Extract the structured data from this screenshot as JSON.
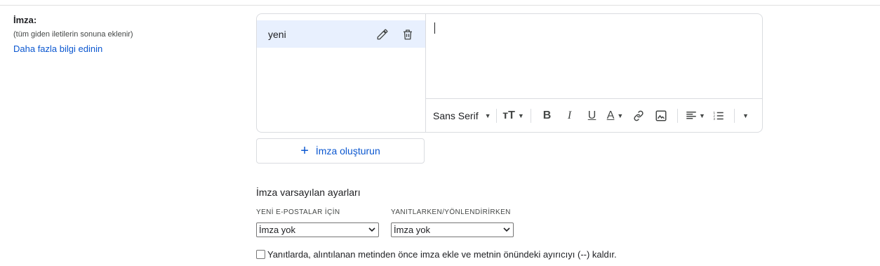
{
  "signature_section": {
    "label": "İmza:",
    "sublabel": "(tüm giden iletilerin sonuna eklenir)",
    "link": "Daha fazla bilgi edinin"
  },
  "signatures": [
    {
      "name": "yeni",
      "selected": true
    }
  ],
  "toolbar": {
    "font_name": "Sans Serif",
    "icons": [
      "font-size-icon",
      "bold-icon",
      "italic-icon",
      "underline-icon",
      "text-color-icon",
      "link-icon",
      "image-icon",
      "align-icon",
      "numbered-list-icon",
      "more-icon"
    ]
  },
  "create_button": {
    "label": "İmza oluşturun"
  },
  "defaults": {
    "title": "İmza varsayılan ayarları",
    "new_mail": {
      "label": "YENİ E-POSTALAR İÇİN",
      "value": "İmza yok"
    },
    "reply_forward": {
      "label": "YANITLARKEN/YÖNLENDİRİRKEN",
      "value": "İmza yok"
    }
  },
  "checkbox": {
    "label": "Yanıtlarda, alıntılanan metinden önce imza ekle ve metnin önündeki ayırıcıyı (--) kaldır.",
    "checked": false
  },
  "colors": {
    "accent": "#0b57d0",
    "selected_bg": "#e8f0fe",
    "border": "#dadce0"
  }
}
